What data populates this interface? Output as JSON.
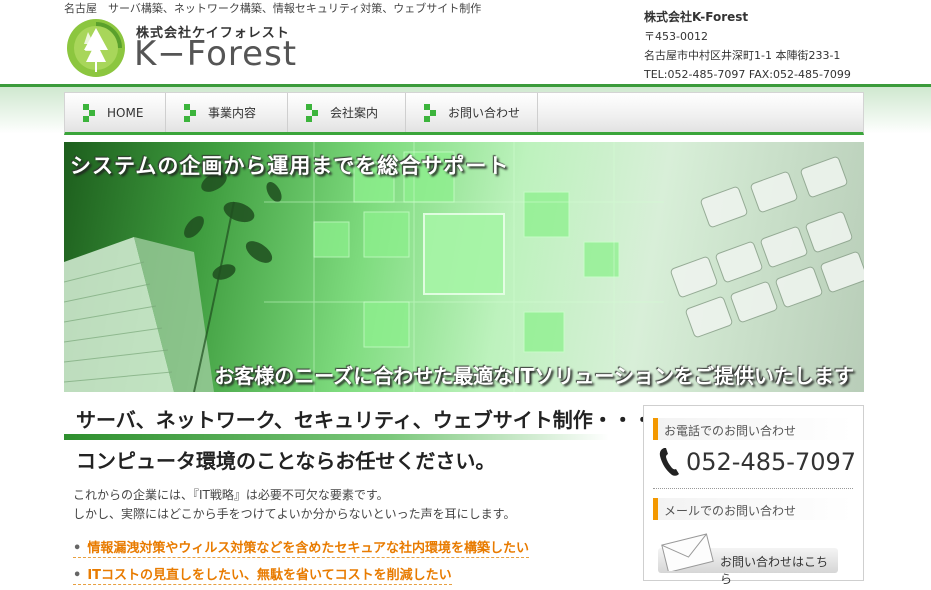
{
  "header": {
    "tagline": "名古屋　サーバ構築、ネットワーク構築、情報セキュリティ対策、ウェブサイト制作",
    "logo_sub": "株式会社ケイフォレスト",
    "logo_main": "K−Forest",
    "company_name": "株式会社K-Forest",
    "postal": "〒453-0012",
    "address": "名古屋市中村区井深町1-1 本陣街233-1",
    "tel_fax": "TEL:052-485-7097  FAX:052-485-7099"
  },
  "nav": {
    "items": [
      {
        "label": "HOME"
      },
      {
        "label": "事業内容"
      },
      {
        "label": "会社案内"
      },
      {
        "label": "お問い合わせ"
      }
    ]
  },
  "banner": {
    "top_text": "システムの企画から運用までを総合サポート",
    "bottom_text": "お客様のニーズに合わせた最適なITソリューションをご提供いたします"
  },
  "main": {
    "heading1": "サーバ、ネットワーク、セキュリティ、ウェブサイト制作・・・",
    "heading2": "コンピュータ環境のことならお任せください。",
    "para1": "これからの企業には、『IT戦略』は必要不可欠な要素です。",
    "para2": "しかし、実際にはどこから手をつけてよいか分からないといった声を耳にします。",
    "bullets": [
      "情報漏洩対策やウィルス対策などを含めたセキュアな社内環境を構築したい",
      "ITコストの見直しをしたい、無駄を省いてコストを削減したい"
    ]
  },
  "contact": {
    "phone_label": "お電話でのお問い合わせ",
    "phone_number": "052-485-7097",
    "mail_label": "メールでのお問い合わせ",
    "mail_button": "お問い合わせはこちら"
  },
  "colors": {
    "brand_green": "#3aa53a",
    "accent_orange": "#f39800",
    "link_orange": "#e87b00"
  }
}
